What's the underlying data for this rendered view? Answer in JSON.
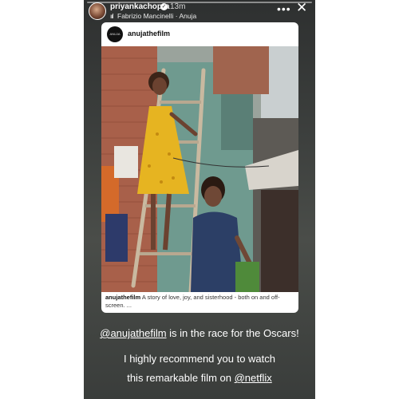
{
  "header": {
    "username": "priyankachopra",
    "time": "13m",
    "music": "Fabrizio Mancinelli · Anuja",
    "music_icon": "bars-icon",
    "more_icon": "•••",
    "close_icon": "✕"
  },
  "card": {
    "username": "anujathefilm",
    "avatar_text": "ANUJA",
    "caption_user": "anujathefilm",
    "caption_text": "A story of love, joy, and sisterhood - both on and off-screen. ..."
  },
  "overlay": {
    "line1_mention": "@anujathefilm",
    "line1_rest": " is in the race for the Oscars!",
    "line2": "I highly recommend you to watch",
    "line3_start": "this remarkable film on ",
    "line3_mention": "@netflix"
  },
  "colors": {
    "background": "#3d403e",
    "card": "#ffffff",
    "text": "#ffffff"
  }
}
